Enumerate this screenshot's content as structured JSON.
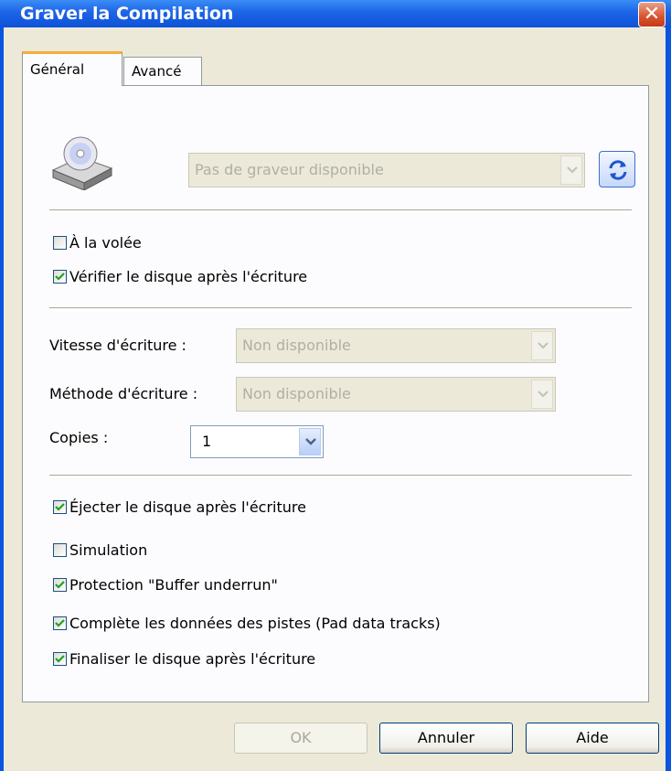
{
  "window": {
    "title": "Graver la Compilation"
  },
  "tabs": [
    {
      "label": "Général"
    },
    {
      "label": "Avancé"
    }
  ],
  "drive": {
    "selected": "Pas de graveur disponible"
  },
  "checks_top": [
    {
      "label": "À la volée",
      "checked": false
    },
    {
      "label": "Vérifier le disque après l'écriture",
      "checked": true
    }
  ],
  "speed": {
    "label": "Vitesse d'écriture :",
    "value": "Non disponible"
  },
  "method": {
    "label": "Méthode d'écriture :",
    "value": "Non disponible"
  },
  "copies": {
    "label": "Copies :",
    "value": "1"
  },
  "checks_bottom": [
    {
      "label": "Éjecter le disque après l'écriture",
      "checked": true
    },
    {
      "label": "Simulation",
      "checked": false
    },
    {
      "label": "Protection \"Buffer underrun\"",
      "checked": true
    },
    {
      "label": "Complète les données des pistes (Pad data tracks)",
      "checked": true
    },
    {
      "label": "Finaliser le disque après l'écriture",
      "checked": true
    }
  ],
  "buttons": {
    "ok": "OK",
    "cancel": "Annuler",
    "help": "Aide"
  },
  "colors": {
    "titlebar": "#0B54E0",
    "check": "#21A121",
    "tab_accent": "#F2AF3C"
  }
}
